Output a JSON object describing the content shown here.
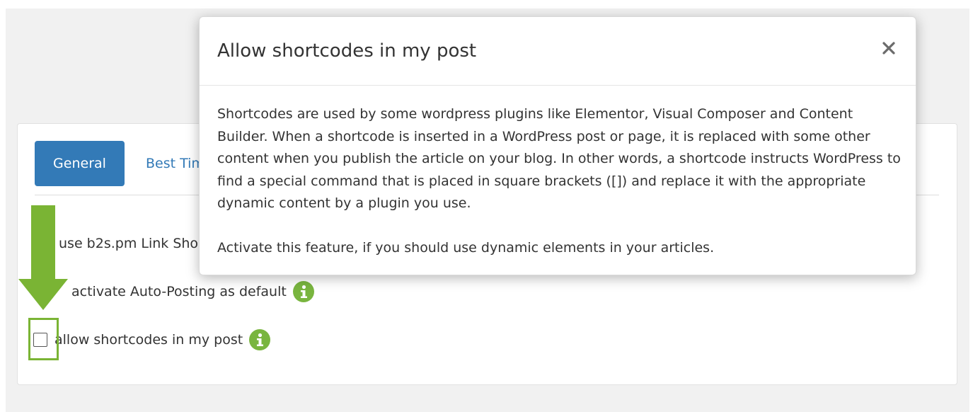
{
  "tabs": {
    "general": "General",
    "best_times": "Best Tim"
  },
  "options": {
    "link_shortener": "use b2s.pm Link Sho",
    "auto_posting": "activate Auto-Posting as default",
    "shortcodes": "allow shortcodes in my post"
  },
  "modal": {
    "title": "Allow shortcodes in my post",
    "close": "×",
    "paragraph1": "Shortcodes are used by some wordpress plugins like Elementor, Visual Composer and Content Builder. When a shortcode is inserted in a WordPress post or page, it is replaced with some other content when you publish the article on your blog. In other words, a shortcode instructs WordPress to find a special command that is placed in square brackets ([]) and replace it with the appropriate dynamic content by a plugin you use.",
    "paragraph2": "Activate this feature, if you should use dynamic elements in your articles."
  },
  "colors": {
    "primary": "#337ab7",
    "info_icon": "#79b53f",
    "annotation": "#7ab434"
  },
  "icons": {
    "info": "info-icon",
    "close": "close-icon",
    "annotation_arrow": "arrow-down-icon"
  }
}
